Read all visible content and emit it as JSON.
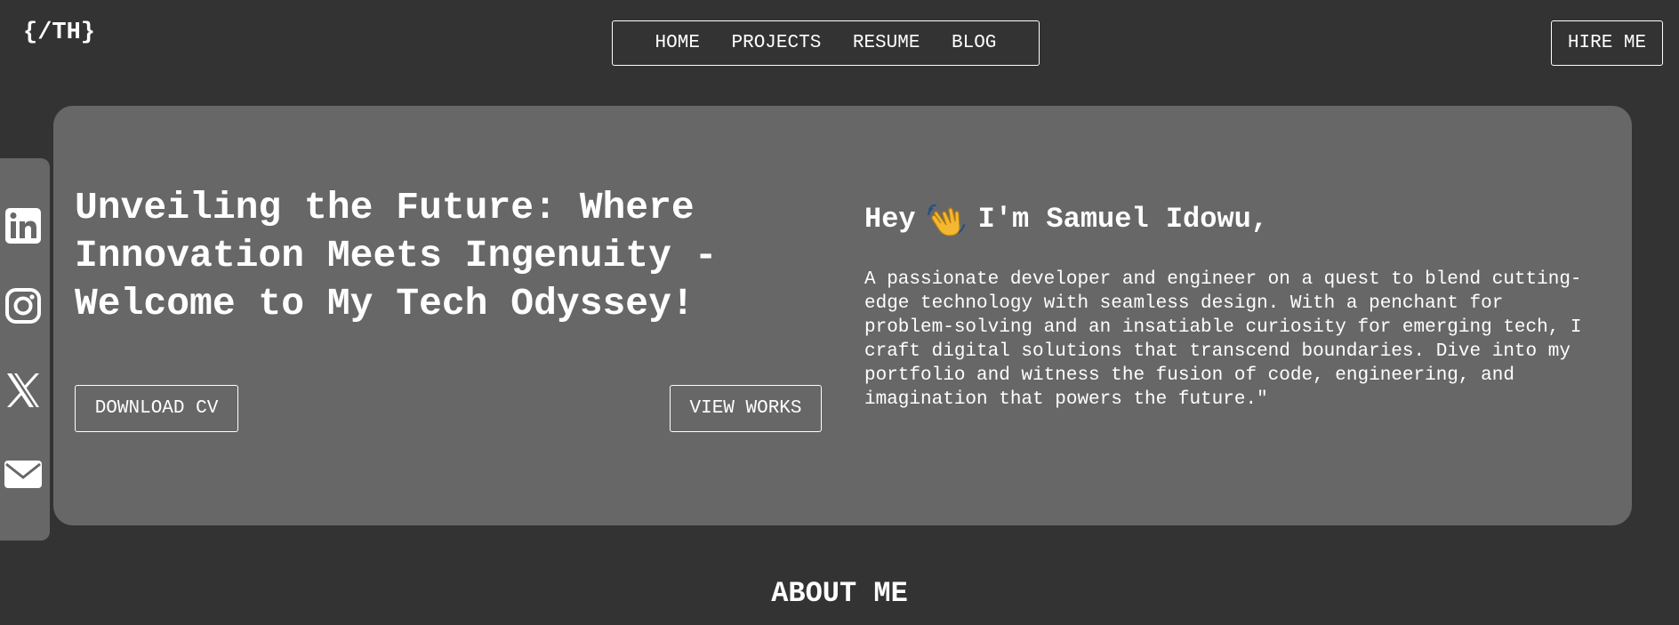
{
  "header": {
    "logo": "{/TH}",
    "nav": [
      {
        "label": "HOME"
      },
      {
        "label": "PROJECTS"
      },
      {
        "label": "RESUME"
      },
      {
        "label": "BLOG"
      }
    ],
    "hire_label": "HIRE ME"
  },
  "social": {
    "icons": [
      "linkedin-icon",
      "instagram-icon",
      "x-twitter-icon",
      "mail-icon"
    ]
  },
  "hero": {
    "headline": "Unveiling the Future: Where Innovation Meets Ingenuity - Welcome to My Tech Odyssey!",
    "download_label": "DOWNLOAD CV",
    "view_works_label": "VIEW WORKS",
    "greeting_prefix": "Hey",
    "greeting_icon": "waving-hand-icon",
    "greeting_suffix": "I'm Samuel Idowu,",
    "bio": "A passionate developer and engineer on a quest to blend cutting-edge technology with seamless design. With a penchant for problem-solving and an insatiable curiosity for emerging tech, I craft digital solutions that transcend boundaries. Dive into my portfolio and witness the fusion of code, engineering, and imagination that powers the future.\""
  },
  "about": {
    "title": "ABOUT ME"
  },
  "colors": {
    "page_background": "#333333",
    "panel_background": "#676767",
    "text": "#ffffff",
    "wave_emoji": "#f4b731"
  }
}
